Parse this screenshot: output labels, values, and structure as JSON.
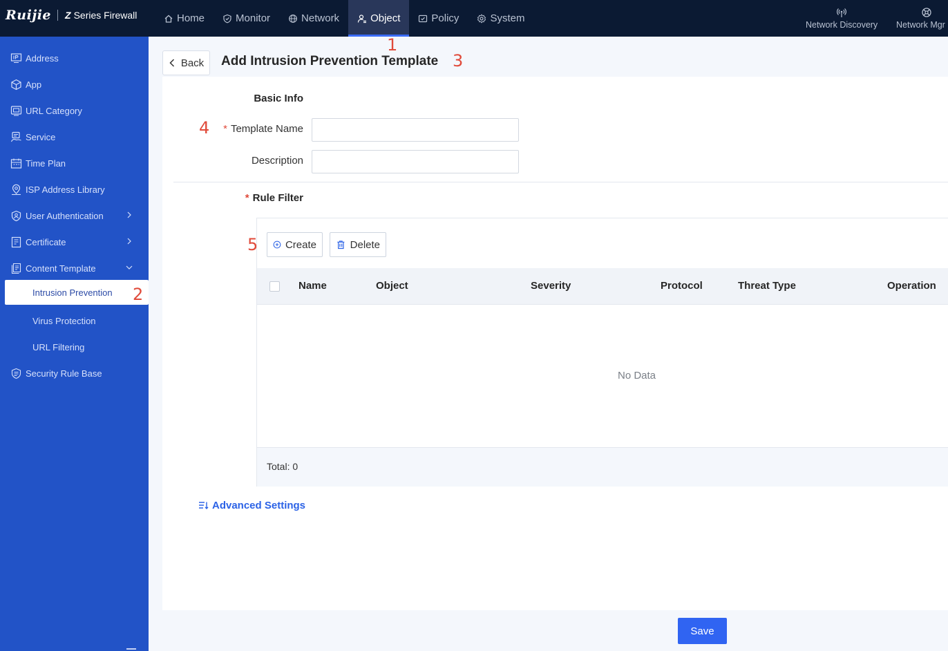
{
  "header": {
    "brand_logo": "Ruijie",
    "brand_product": "Series Firewall",
    "nav": [
      {
        "label": "Home",
        "icon": "home-icon"
      },
      {
        "label": "Monitor",
        "icon": "shield-icon"
      },
      {
        "label": "Network",
        "icon": "globe-icon"
      },
      {
        "label": "Object",
        "icon": "user-object-icon",
        "active": true
      },
      {
        "label": "Policy",
        "icon": "policy-icon"
      },
      {
        "label": "System",
        "icon": "gear-icon"
      }
    ],
    "right_items": [
      {
        "label": "Network Discovery",
        "icon": "signal-icon"
      },
      {
        "label": "Network Mgr",
        "icon": "network-mgr-icon"
      }
    ]
  },
  "sidebar": {
    "items": [
      {
        "label": "Address",
        "icon": "ip-icon"
      },
      {
        "label": "App",
        "icon": "cube-icon"
      },
      {
        "label": "URL Category",
        "icon": "url-category-icon"
      },
      {
        "label": "Service",
        "icon": "service-icon"
      },
      {
        "label": "Time Plan",
        "icon": "calendar-icon"
      },
      {
        "label": "ISP Address Library",
        "icon": "location-icon"
      },
      {
        "label": "User Authentication",
        "icon": "user-shield-icon",
        "expand": "collapsed"
      },
      {
        "label": "Certificate",
        "icon": "certificate-icon",
        "expand": "collapsed"
      },
      {
        "label": "Content Template",
        "icon": "document-icon",
        "expand": "expanded"
      }
    ],
    "sub_items": [
      {
        "label": "Intrusion Prevention",
        "active": true
      },
      {
        "label": "Virus Protection"
      },
      {
        "label": "URL Filtering"
      }
    ],
    "bottom_item": {
      "label": "Security Rule Base",
      "icon": "rule-base-icon"
    }
  },
  "page": {
    "back_label": "Back",
    "title": "Add Intrusion Prevention Template"
  },
  "annotations": [
    "1",
    "2",
    "3",
    "4",
    "5"
  ],
  "form": {
    "basic_info_label": "Basic Info",
    "required_mark": "*",
    "template_name_label": "Template Name",
    "template_name_value": "",
    "description_label": "Description",
    "description_value": "",
    "rule_filter_label": "Rule Filter"
  },
  "table": {
    "create_label": "Create",
    "delete_label": "Delete",
    "columns": [
      "Name",
      "Object",
      "Severity",
      "Protocol",
      "Threat Type",
      "Operation"
    ],
    "empty_text": "No Data",
    "total_text": "Total: 0"
  },
  "advanced_settings_label": "Advanced Settings",
  "save_label": "Save",
  "colors": {
    "topbar": "#0b1a33",
    "sidebar": "#2253c7",
    "accent": "#3064f2",
    "annotation": "#e04a3a"
  }
}
